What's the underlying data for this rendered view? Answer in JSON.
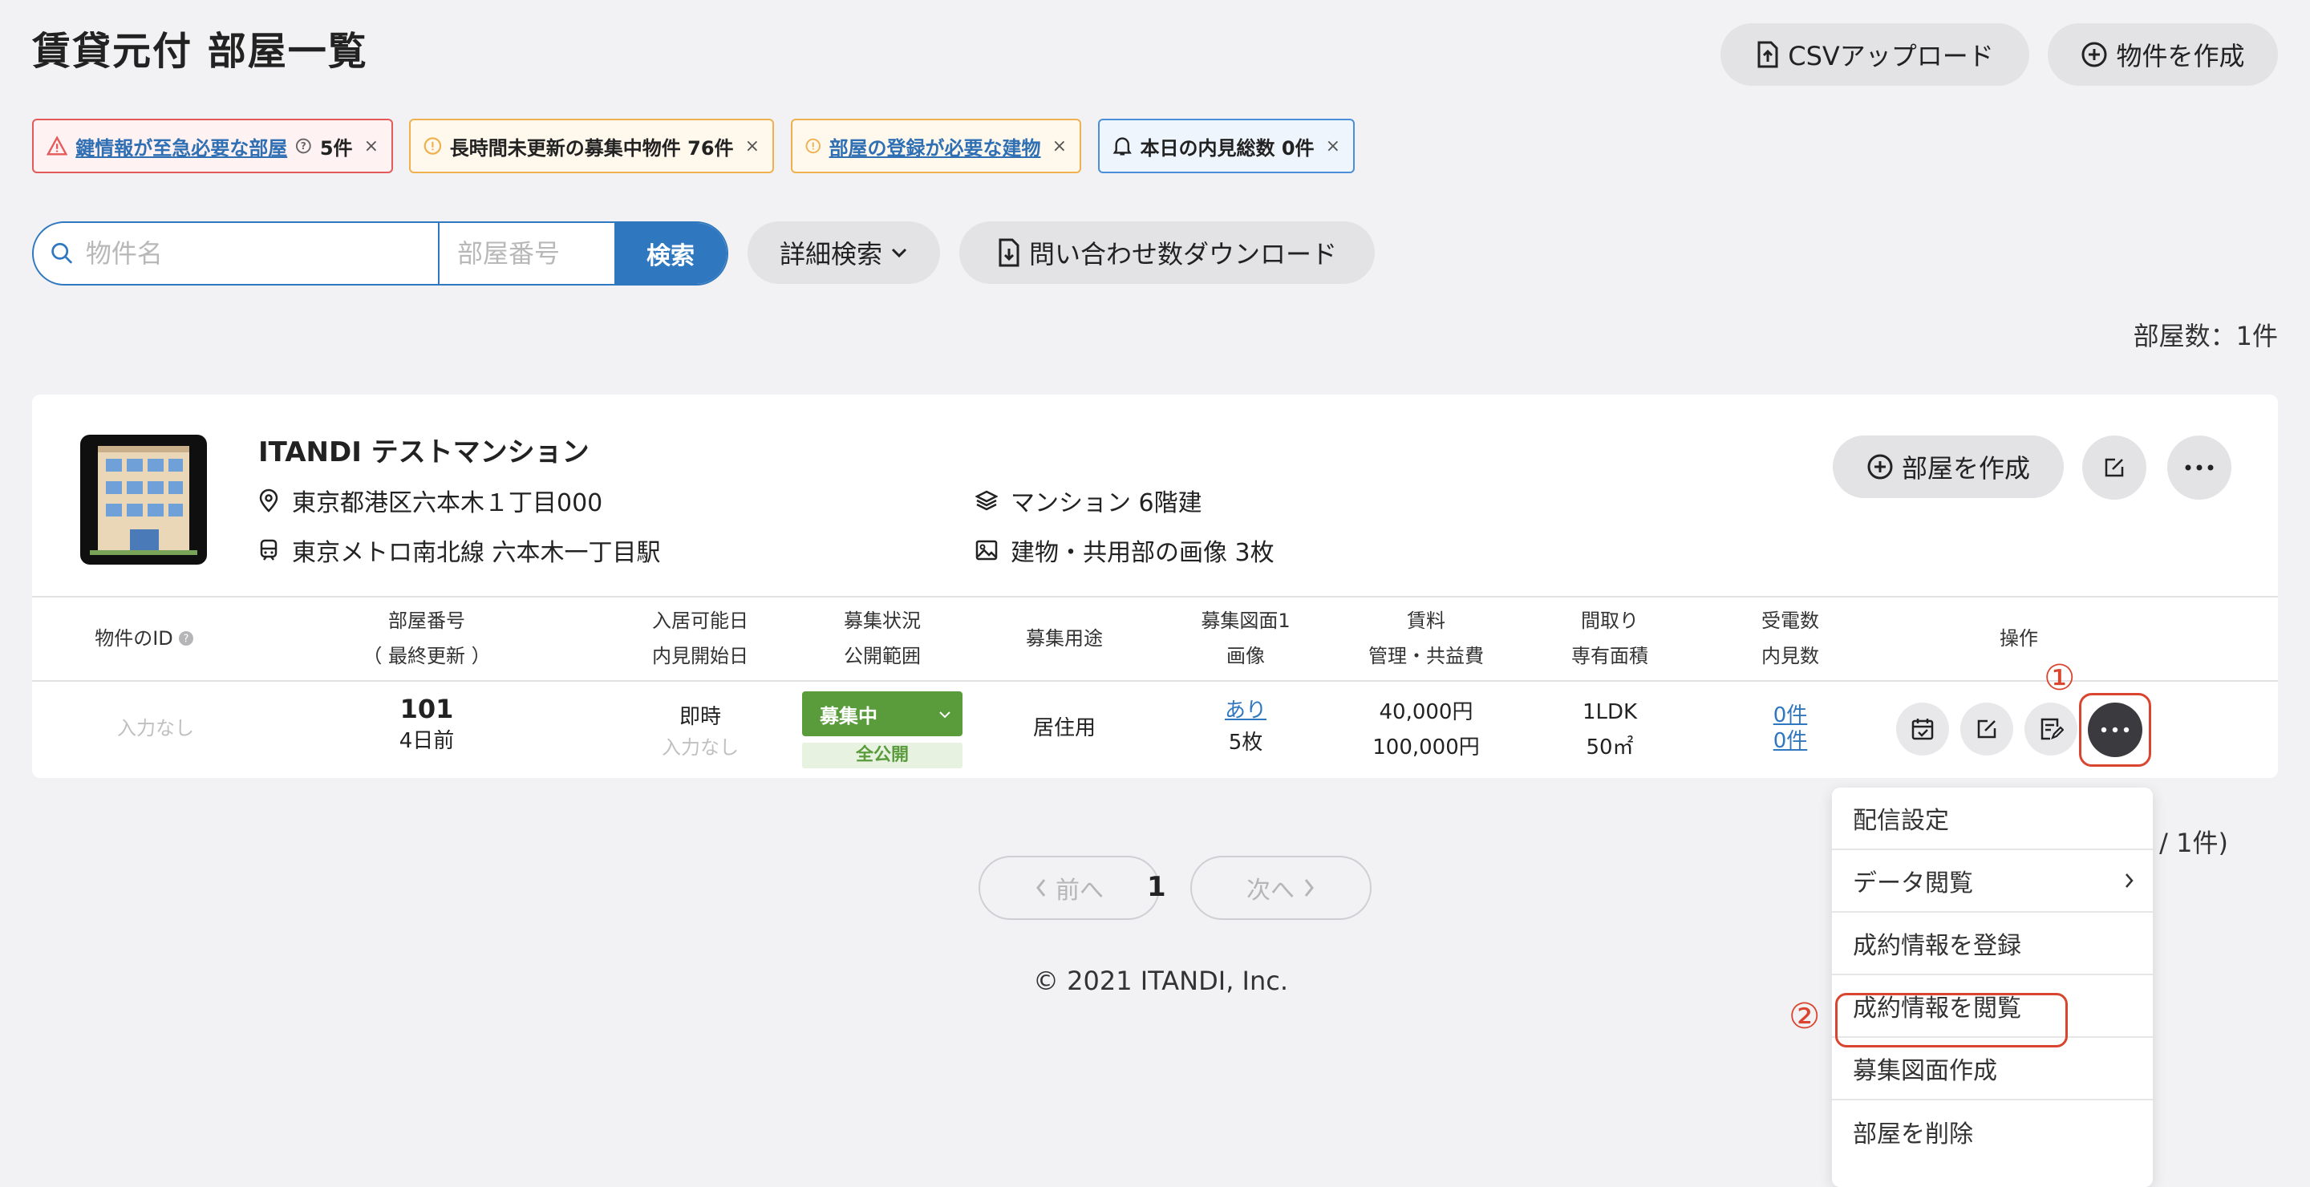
{
  "header": {
    "title": "賃貸元付 部屋一覧",
    "csv_upload": "CSVアップロード",
    "create_property": "物件を作成"
  },
  "alerts": [
    {
      "label": "鍵情報が至急必要な部屋",
      "suffix": "5件",
      "close": "×"
    },
    {
      "label": "長時間未更新の募集中物件 76件",
      "close": "×"
    },
    {
      "label": "部屋の登録が必要な建物",
      "close": "×"
    },
    {
      "label": "本日の内見総数 0件",
      "close": "×"
    }
  ],
  "search": {
    "name_placeholder": "物件名",
    "room_placeholder": "部屋番号",
    "button": "検索",
    "advanced": "詳細検索",
    "download": "問い合わせ数ダウンロード"
  },
  "room_count": "部屋数：1件",
  "property": {
    "name": "ITANDI テストマンション",
    "address": "東京都港区六本木１丁目000",
    "station": "東京メトロ南北線 六本木一丁目駅",
    "building_type": "マンション 6階建",
    "photos": "建物・共用部の画像 3枚",
    "create_room": "部屋を作成"
  },
  "table": {
    "headers": {
      "prop_id": "物件のID",
      "room_no": "部屋番号",
      "room_no_sub": "（ 最終更新 ）",
      "move_in": "入居可能日",
      "move_in_sub": "内見開始日",
      "status": "募集状況",
      "status_sub": "公開範囲",
      "usage": "募集用途",
      "drawing": "募集図面1",
      "drawing_sub": "画像",
      "rent": "賃料",
      "rent_sub": "管理・共益費",
      "layout": "間取り",
      "layout_sub": "専有面積",
      "calls": "受電数",
      "calls_sub": "内見数",
      "ops": "操作"
    },
    "row": {
      "prop_id": "入力なし",
      "room_no": "101",
      "updated": "4日前",
      "move_in": "即時",
      "viewing_start": "入力なし",
      "status": "募集中",
      "scope": "全公開",
      "usage": "居住用",
      "drawing": "あり",
      "images": "5枚",
      "rent": "40,000円",
      "fee": "100,000円",
      "layout": "1LDK",
      "area": "50㎡",
      "calls": "0件",
      "viewings": "0件"
    }
  },
  "annotations": {
    "one": "①",
    "two": "②"
  },
  "pagination": {
    "prev": "前へ",
    "page": "1",
    "next": "次へ",
    "summary": "件 / 1件)"
  },
  "footer": "© 2021 ITANDI, Inc.",
  "menu": [
    {
      "label": "配信設定"
    },
    {
      "label": "データ閲覧"
    },
    {
      "label": "成約情報を登録"
    },
    {
      "label": "成約情報を閲覧"
    },
    {
      "label": "募集図面作成"
    },
    {
      "label": "部屋を削除"
    }
  ],
  "colors": {
    "primary": "#2f78bf",
    "status_green": "#5a9c3c",
    "annotation_red": "#d9452e",
    "alert_red": "#e45a5a",
    "alert_orange": "#efb150"
  }
}
